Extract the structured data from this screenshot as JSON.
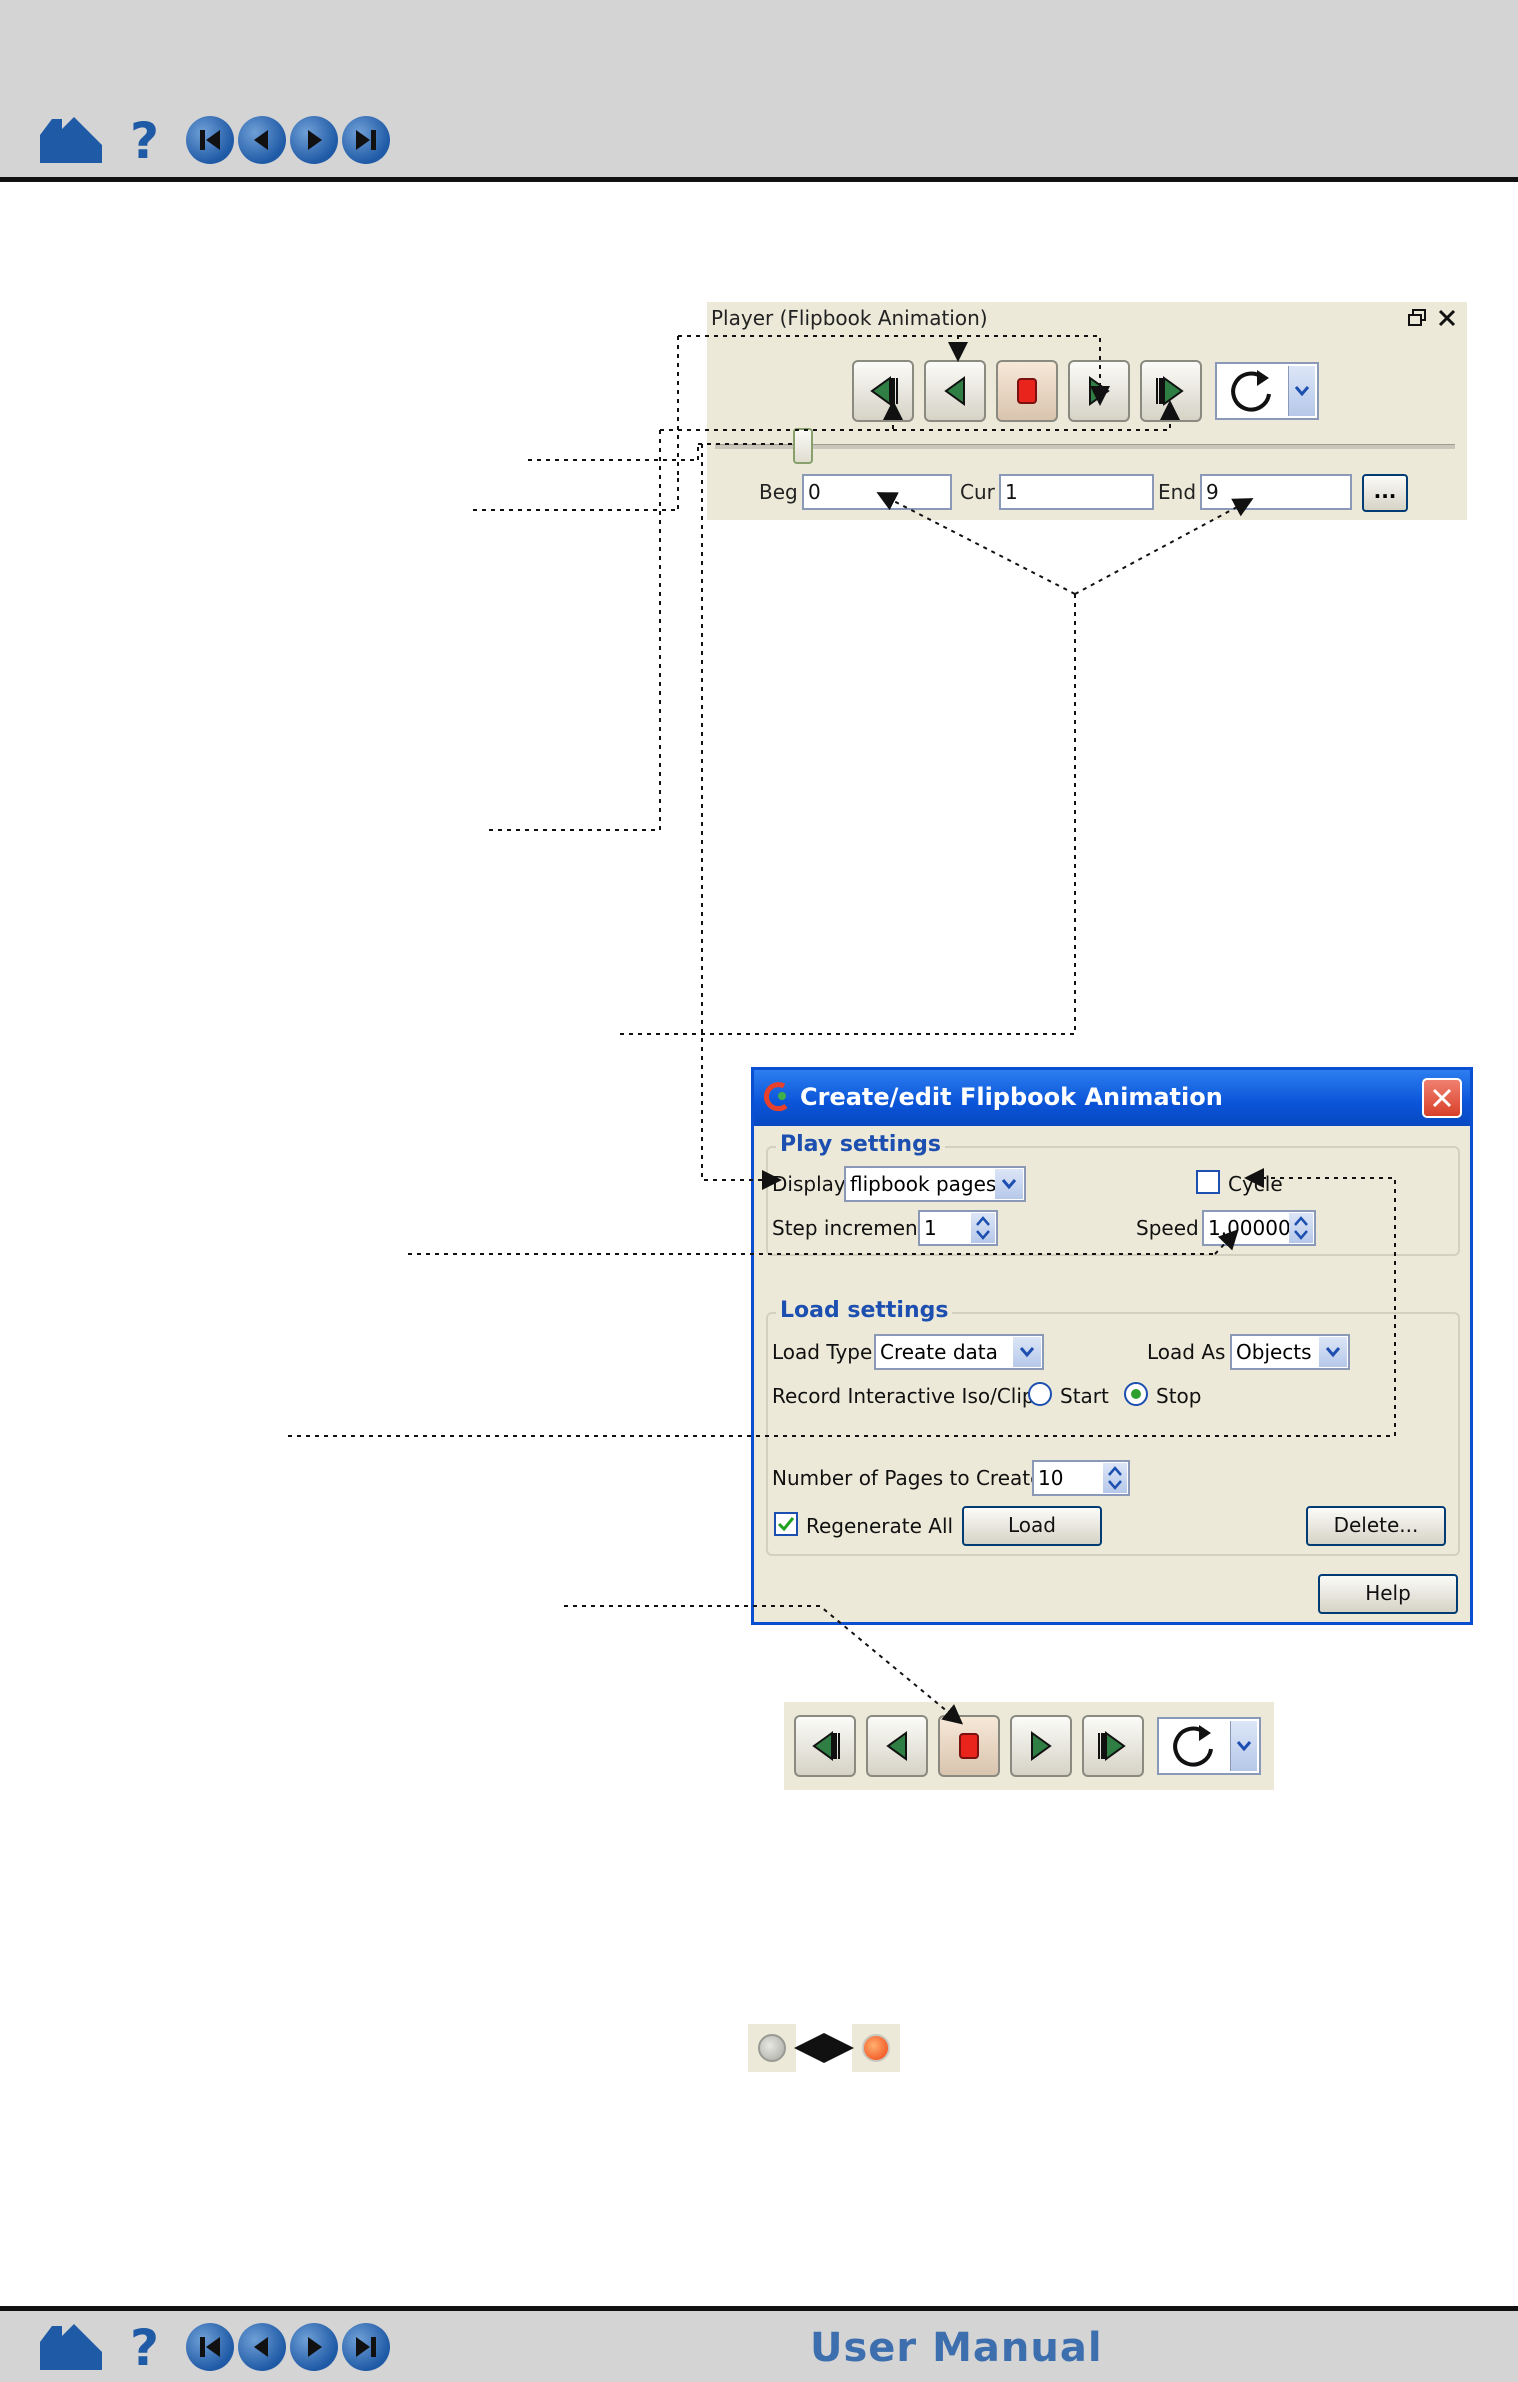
{
  "footer": {
    "title": "User Manual"
  },
  "nav": {
    "icons": [
      "home-icon",
      "help-icon",
      "first-page-icon",
      "previous-page-icon",
      "next-page-icon",
      "last-page-icon"
    ]
  },
  "player": {
    "title": "Player (Flipbook Animation)",
    "beg_label": "Beg",
    "beg_value": "0",
    "cur_label": "Cur",
    "cur_value": "1",
    "end_label": "End",
    "end_value": "9",
    "more_button": "...",
    "slider_position": 1
  },
  "dialog": {
    "title": "Create/edit Flipbook Animation",
    "play_settings": {
      "title": "Play settings",
      "display_label": "Display",
      "display_value": "flipbook pages",
      "cycle_label": "Cycle",
      "cycle_checked": false,
      "step_label": "Step increment",
      "step_value": "1",
      "speed_label": "Speed",
      "speed_value": "1.00000"
    },
    "load_settings": {
      "title": "Load settings",
      "load_type_label": "Load Type",
      "load_type_value": "Create data",
      "load_as_label": "Load As",
      "load_as_value": "Objects",
      "record_label": "Record Interactive Iso/Clip",
      "start_label": "Start",
      "stop_label": "Stop",
      "selected": "Stop",
      "pages_label": "Number of Pages to Create",
      "pages_value": "10",
      "regenerate_label": "Regenerate All",
      "regenerate_checked": true,
      "load_button": "Load",
      "delete_button": "Delete..."
    },
    "help_button": "Help"
  },
  "colors": {
    "panel_bg": "#ece9d8",
    "stop_red": "#e8241c",
    "title_blue": "#0a54d8",
    "nav_blue": "#1f5aa6"
  }
}
